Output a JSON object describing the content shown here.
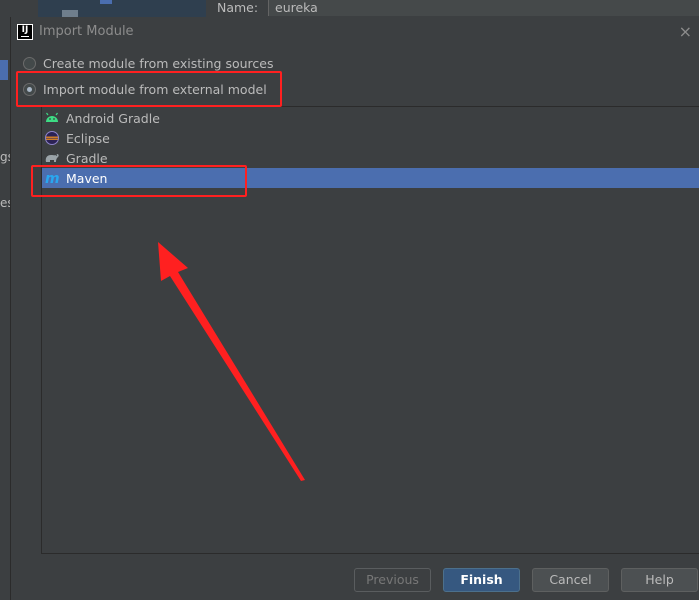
{
  "background": {
    "name_label": "Name:",
    "name_value": "eureka",
    "left_text_1": "gs",
    "left_text_2": "es"
  },
  "dialog": {
    "title": "Import Module",
    "app_icon_text": "IJ",
    "close_glyph": "×",
    "options": [
      {
        "label": "Create module from existing sources",
        "checked": false
      },
      {
        "label": "Import module from external model",
        "checked": true
      }
    ],
    "models": [
      {
        "label": "Android Gradle",
        "icon": "android-icon",
        "selected": false
      },
      {
        "label": "Eclipse",
        "icon": "eclipse-icon",
        "selected": false
      },
      {
        "label": "Gradle",
        "icon": "gradle-elephant-icon",
        "selected": false
      },
      {
        "label": "Maven",
        "icon": "maven-icon",
        "selected": true
      }
    ],
    "buttons": {
      "previous": "Previous",
      "finish": "Finish",
      "cancel": "Cancel",
      "help": "Help"
    }
  },
  "colors": {
    "selection": "#4b6eaf",
    "annotation": "#ff2020",
    "primary_button": "#365880"
  }
}
